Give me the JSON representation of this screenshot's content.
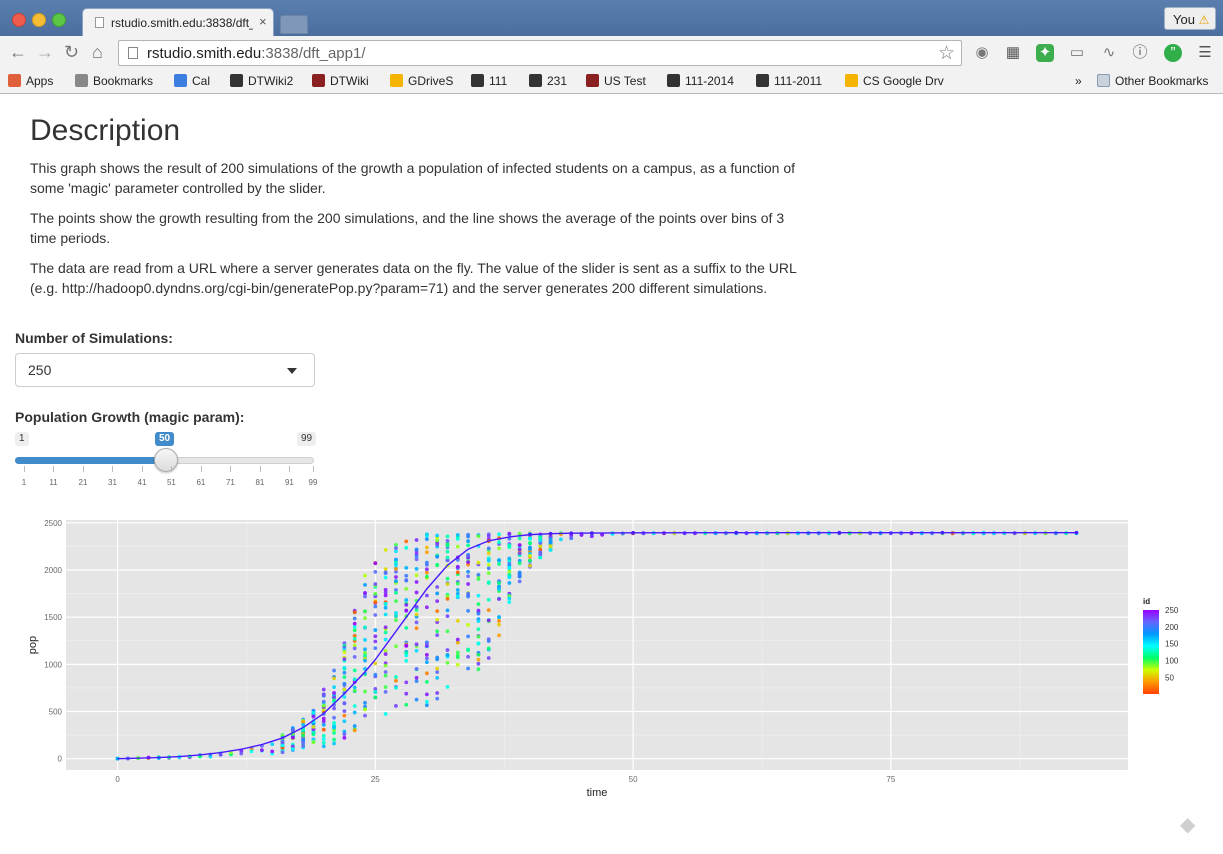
{
  "browser": {
    "tab_title": "rstudio.smith.edu:3838/dft_app1/",
    "tab_close": "×",
    "profile_label": "You",
    "profile_warning": "⚠",
    "url_host": "rstudio.smith.edu",
    "url_path": ":3838/dft_app1/",
    "bookmarks": [
      {
        "label": "Apps",
        "icon": "apps-grid-icon",
        "color": "#e0603c"
      },
      {
        "label": "Bookmarks",
        "icon": "star-icon",
        "color": "#777777"
      },
      {
        "label": "Cal",
        "icon": "google-calendar-icon",
        "color": "#3c7ee0"
      },
      {
        "label": "DTWiki2",
        "icon": "wiki-icon",
        "color": "#333333"
      },
      {
        "label": "DTWiki",
        "icon": "wiki-icon",
        "color": "#8a2020"
      },
      {
        "label": "GDriveS",
        "icon": "google-drive-icon",
        "color": "#f4b400"
      },
      {
        "label": "111",
        "icon": "course-icon",
        "color": "#333333"
      },
      {
        "label": "231",
        "icon": "course-icon",
        "color": "#333333"
      },
      {
        "label": "US Test",
        "icon": "course-icon",
        "color": "#8a2020"
      },
      {
        "label": "111-2014",
        "icon": "course-icon",
        "color": "#333333"
      },
      {
        "label": "111-2011",
        "icon": "course-icon",
        "color": "#333333"
      },
      {
        "label": "CS Google Drv",
        "icon": "google-drive-icon",
        "color": "#f4b400"
      }
    ],
    "bookmarks_overflow": "»",
    "other_bookmarks": "Other Bookmarks"
  },
  "page": {
    "title": "Description",
    "paragraphs": [
      "This graph shows the result of 200 simulations of the growth a population of infected students on a campus, as a function of some 'magic' parameter controlled by the slider.",
      "The points show the growth resulting from the 200 simulations, and the line shows the average of the points over bins of 3 time periods.",
      "The data are read from a URL where a server generates data on the fly. The value of the slider is sent as a suffix to the URL (e.g. http://hadoop0.dyndns.org/cgi-bin/generatePop.py?param=71) and the server generates 200 different simulations."
    ],
    "sim_label": "Number of Simulations:",
    "sim_value": "250",
    "growth_label": "Population Growth (magic param):",
    "slider": {
      "min": 1,
      "max": 99,
      "value": 50,
      "min_label": "1",
      "max_label": "99",
      "value_label": "50",
      "tick_labels": [
        "1",
        "11",
        "21",
        "31",
        "41",
        "51",
        "61",
        "71",
        "81",
        "91",
        "99"
      ]
    }
  },
  "chart_data": {
    "type": "scatter",
    "title": "",
    "xlabel": "time",
    "ylabel": "pop",
    "xlim": [
      -5,
      98
    ],
    "ylim": [
      -120,
      2530
    ],
    "x_ticks": [
      0,
      25,
      50,
      75
    ],
    "y_ticks": [
      0,
      500,
      1000,
      1500,
      2000,
      2500
    ],
    "grid": true,
    "background": "#e5e5e5",
    "legend": {
      "title": "id",
      "placement": "right",
      "ticks": [
        50,
        100,
        150,
        200,
        250
      ],
      "range": [
        1,
        250
      ],
      "colormap": [
        "#ff4000",
        "#ff9900",
        "#ccff00",
        "#00ff66",
        "#00ffff",
        "#0099ff",
        "#6666ff",
        "#9900ff"
      ]
    },
    "series": [
      {
        "kind": "points",
        "description_x_range": [
          0,
          93
        ],
        "band": {
          "x": [
            0,
            5,
            10,
            12,
            15,
            17,
            19,
            20,
            21,
            22,
            23,
            24,
            25,
            26,
            27,
            28,
            29,
            30,
            31,
            32,
            33,
            34,
            35,
            36,
            37,
            38,
            39,
            40,
            42,
            44,
            46,
            48,
            50
          ],
          "low": [
            0,
            5,
            20,
            30,
            50,
            70,
            100,
            130,
            160,
            200,
            230,
            270,
            300,
            330,
            380,
            420,
            470,
            520,
            580,
            650,
            720,
            800,
            900,
            1050,
            1250,
            1500,
            1800,
            2000,
            2200,
            2300,
            2350,
            2380,
            2390
          ],
          "high": [
            0,
            20,
            60,
            90,
            200,
            330,
            520,
            750,
            1000,
            1250,
            1600,
            1950,
            2100,
            2250,
            2300,
            2350,
            2380,
            2390,
            2390,
            2390,
            2390,
            2390,
            2390,
            2390,
            2390,
            2390,
            2390,
            2390,
            2390,
            2390,
            2390,
            2390,
            2390
          ]
        }
      },
      {
        "kind": "line",
        "color": "#4a1aff",
        "x": [
          0,
          2,
          4,
          6,
          8,
          10,
          12,
          14,
          16,
          18,
          20,
          22,
          24,
          25,
          26,
          28,
          30,
          32,
          34,
          36,
          38,
          40,
          42,
          44,
          46,
          50,
          60,
          70,
          80,
          93
        ],
        "y": [
          0,
          5,
          12,
          22,
          40,
          65,
          100,
          150,
          220,
          330,
          480,
          690,
          920,
          1050,
          1200,
          1500,
          1800,
          2050,
          2220,
          2310,
          2350,
          2375,
          2385,
          2390,
          2392,
          2394,
          2395,
          2395,
          2395,
          2395
        ]
      }
    ]
  }
}
